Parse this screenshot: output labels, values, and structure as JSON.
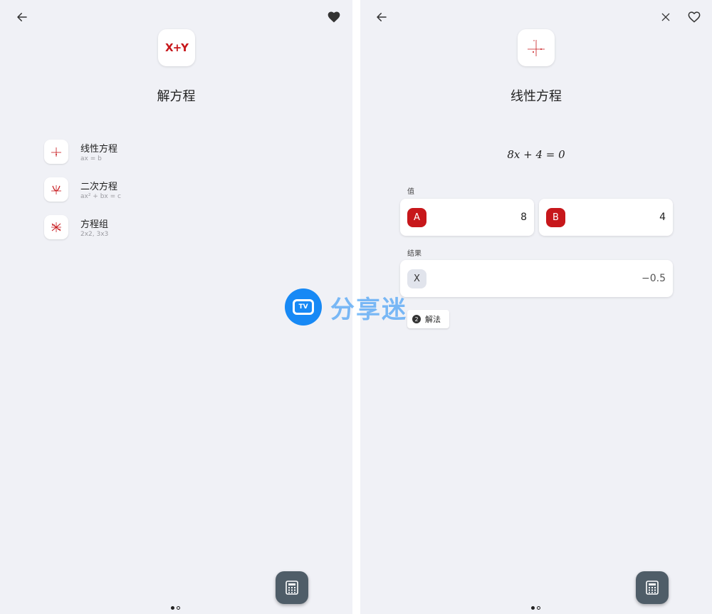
{
  "left": {
    "title": "解方程",
    "items": [
      {
        "title": "线性方程",
        "sub": "ax = b"
      },
      {
        "title": "二次方程",
        "sub": "ax² + bx = c"
      },
      {
        "title": "方程组",
        "sub": "2x2, 3x3"
      }
    ]
  },
  "right": {
    "title": "线性方程",
    "equation": "8x + 4 = 0",
    "values_label": "值",
    "param_a": {
      "label": "A",
      "value": "8"
    },
    "param_b": {
      "label": "B",
      "value": "4"
    },
    "result_label": "结果",
    "result": {
      "label": "X",
      "value": "−0.5"
    },
    "solution_chip": {
      "num": "2",
      "label": "解法"
    }
  },
  "logo_text": "X+Y",
  "watermark": {
    "icon_text": "TV",
    "text": "分享迷"
  },
  "colors": {
    "accent_red": "#c7171b",
    "background": "#f0f1f6",
    "fab": "#4f5d68",
    "watermark_blue": "#1789f5"
  }
}
